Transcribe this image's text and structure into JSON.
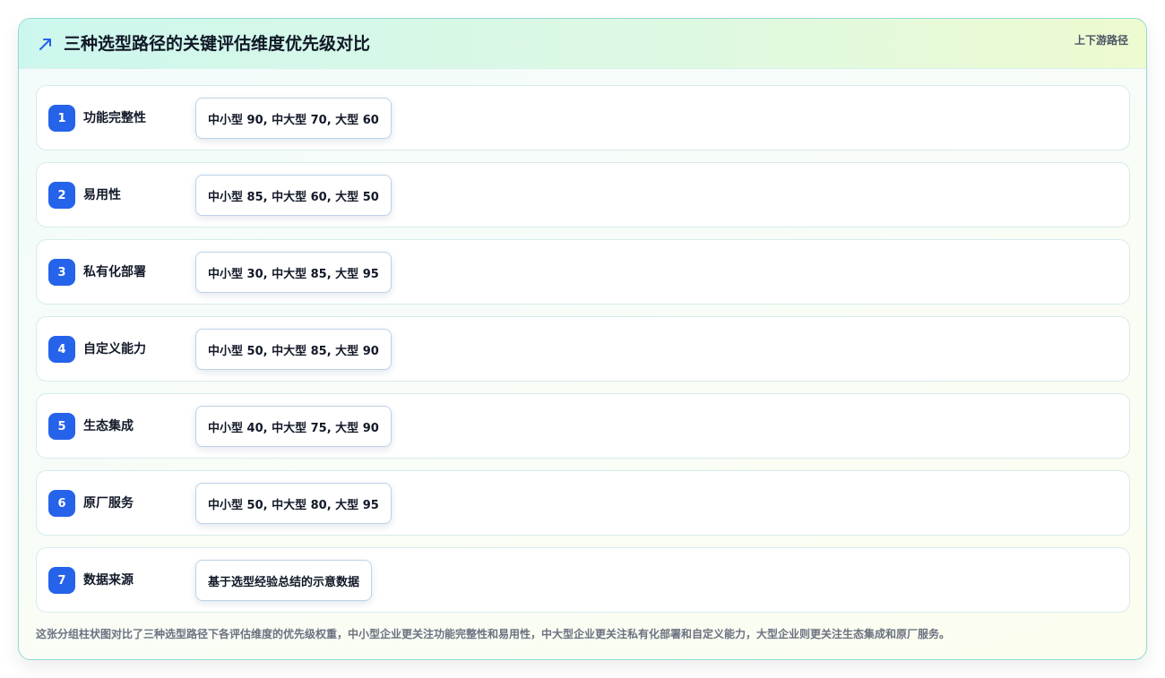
{
  "header": {
    "icon": "trend-arrow-icon",
    "title": "三种选型路径的关键评估维度优先级对比",
    "tag": "上下游路径"
  },
  "rows": [
    {
      "index": "1",
      "label": "功能完整性",
      "value": "中小型 90, 中大型 70, 大型 60"
    },
    {
      "index": "2",
      "label": "易用性",
      "value": "中小型 85, 中大型 60, 大型 50"
    },
    {
      "index": "3",
      "label": "私有化部署",
      "value": "中小型 30, 中大型 85, 大型 95"
    },
    {
      "index": "4",
      "label": "自定义能力",
      "value": "中小型 50, 中大型 85, 大型 90"
    },
    {
      "index": "5",
      "label": "生态集成",
      "value": "中小型 40, 中大型 75, 大型 90"
    },
    {
      "index": "6",
      "label": "原厂服务",
      "value": "中小型 50, 中大型 80, 大型 95"
    },
    {
      "index": "7",
      "label": "数据来源",
      "value": "基于选型经验总结的示意数据"
    }
  ],
  "footnote": "这张分组柱状图对比了三种选型路径下各评估维度的优先级权重，中小型企业更关注功能完整性和易用性，中大型企业更关注私有化部署和自定义能力，大型企业则更关注生态集成和原厂服务。",
  "colors": {
    "accent": "#2563eb",
    "border": "#8fdcd0"
  }
}
